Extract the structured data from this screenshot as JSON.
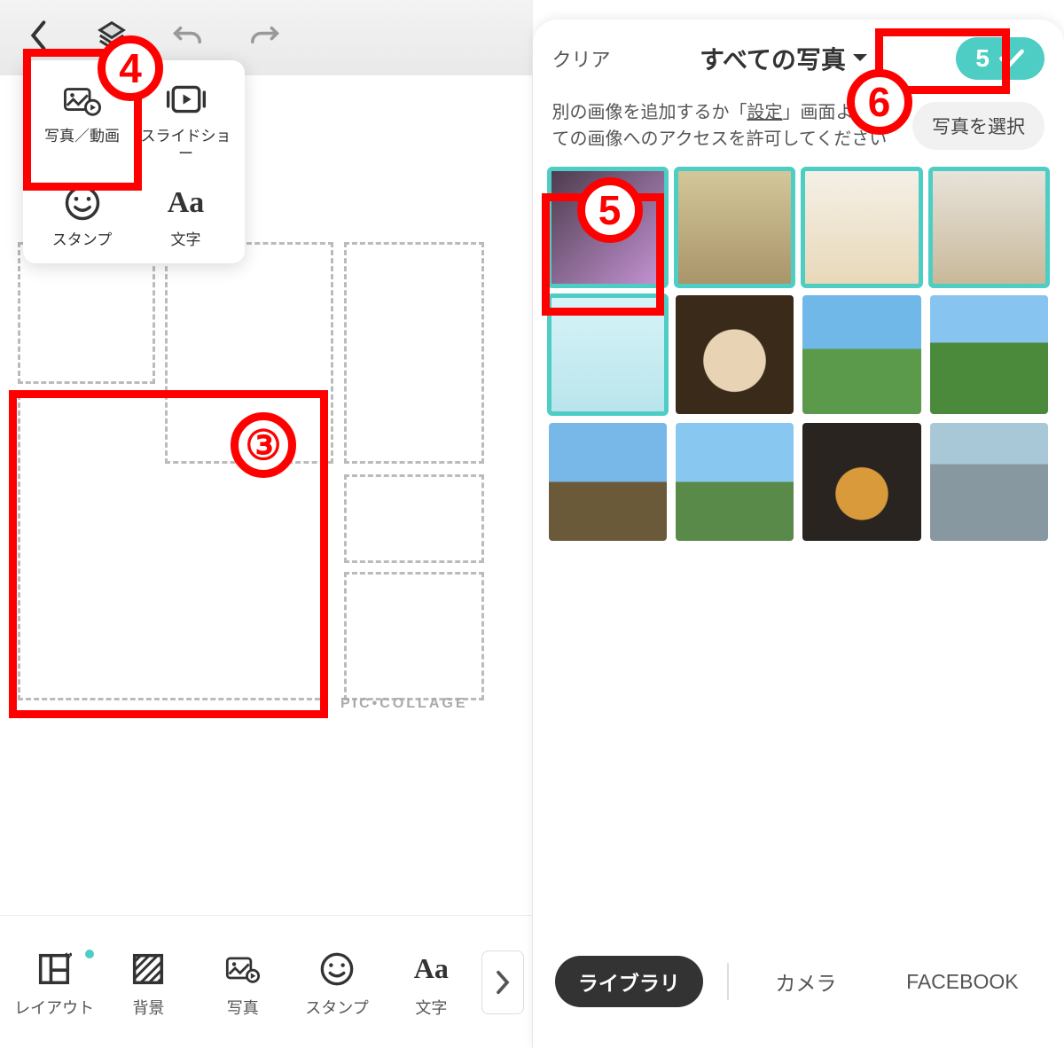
{
  "annotations": {
    "n3": "③",
    "n4": "4",
    "n5": "5",
    "n6": "6"
  },
  "left": {
    "popup": {
      "photo_video": "写真／動画",
      "slideshow": "スライドショー",
      "stamp": "スタンプ",
      "text": "文字"
    },
    "bottom": {
      "layout": "レイアウト",
      "background": "背景",
      "photo": "写真",
      "stamp": "スタンプ",
      "text": "文字"
    },
    "watermark": "PIC•COLLAGE"
  },
  "right": {
    "clear": "クリア",
    "title": "すべての写真",
    "confirm_count": "5",
    "subtitle_1": "別の画像を追加するか「",
    "subtitle_link": "設定",
    "subtitle_2": "」画面より全ての画像へのアクセスを許可してください",
    "select_photos": "写真を選択",
    "thumbs": [
      {
        "sel": true
      },
      {
        "sel": true
      },
      {
        "sel": true
      },
      {
        "sel": true
      },
      {
        "sel": true
      },
      {
        "sel": false
      },
      {
        "sel": false
      },
      {
        "sel": false
      },
      {
        "sel": false
      },
      {
        "sel": false
      },
      {
        "sel": false
      },
      {
        "sel": false
      }
    ],
    "bottom": {
      "library": "ライブラリ",
      "camera": "カメラ",
      "facebook": "FACEBOOK"
    }
  }
}
